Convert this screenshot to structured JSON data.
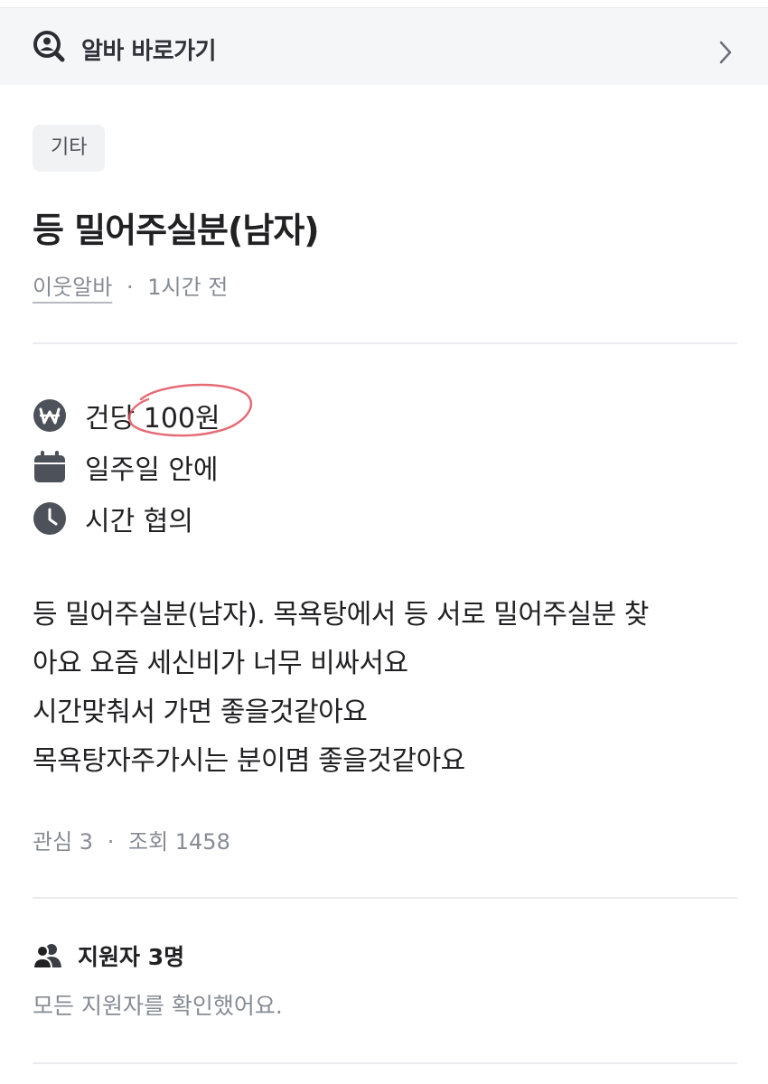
{
  "shortcut_bar": {
    "label": "알바 바로가기",
    "icon": "user-search-icon",
    "chevron": "chevron-right-icon"
  },
  "post": {
    "category": "기타",
    "title": "등 밀어주실분(남자)",
    "author": "이웃알바",
    "separator": "·",
    "posted_ago": "1시간 전"
  },
  "details": {
    "pay": {
      "icon": "won-icon",
      "text": "건당 100원"
    },
    "period": {
      "icon": "calendar-icon",
      "text": "일주일 안에"
    },
    "time": {
      "icon": "clock-icon",
      "text": "시간 협의"
    }
  },
  "description_lines": [
    "등 밀어주실분(남자). 목욕탕에서 등 서로 밀어주실분 찾",
    "아요 요즘 세신비가 너무 비싸서요",
    "시간맞춰서 가면 좋을것같아요",
    "목욕탕자주가시는 분이몀 좋을것같아요"
  ],
  "stats": {
    "interest": "관심 3",
    "separator": "·",
    "views": "조회 1458"
  },
  "applicants": {
    "icon": "users-icon",
    "label": "지원자 3명",
    "status": "모든 지원자를 확인했어요."
  },
  "colors": {
    "text": "#212124",
    "muted": "#868b94",
    "icon": "#4d5159",
    "annotation": "#e0525e"
  }
}
